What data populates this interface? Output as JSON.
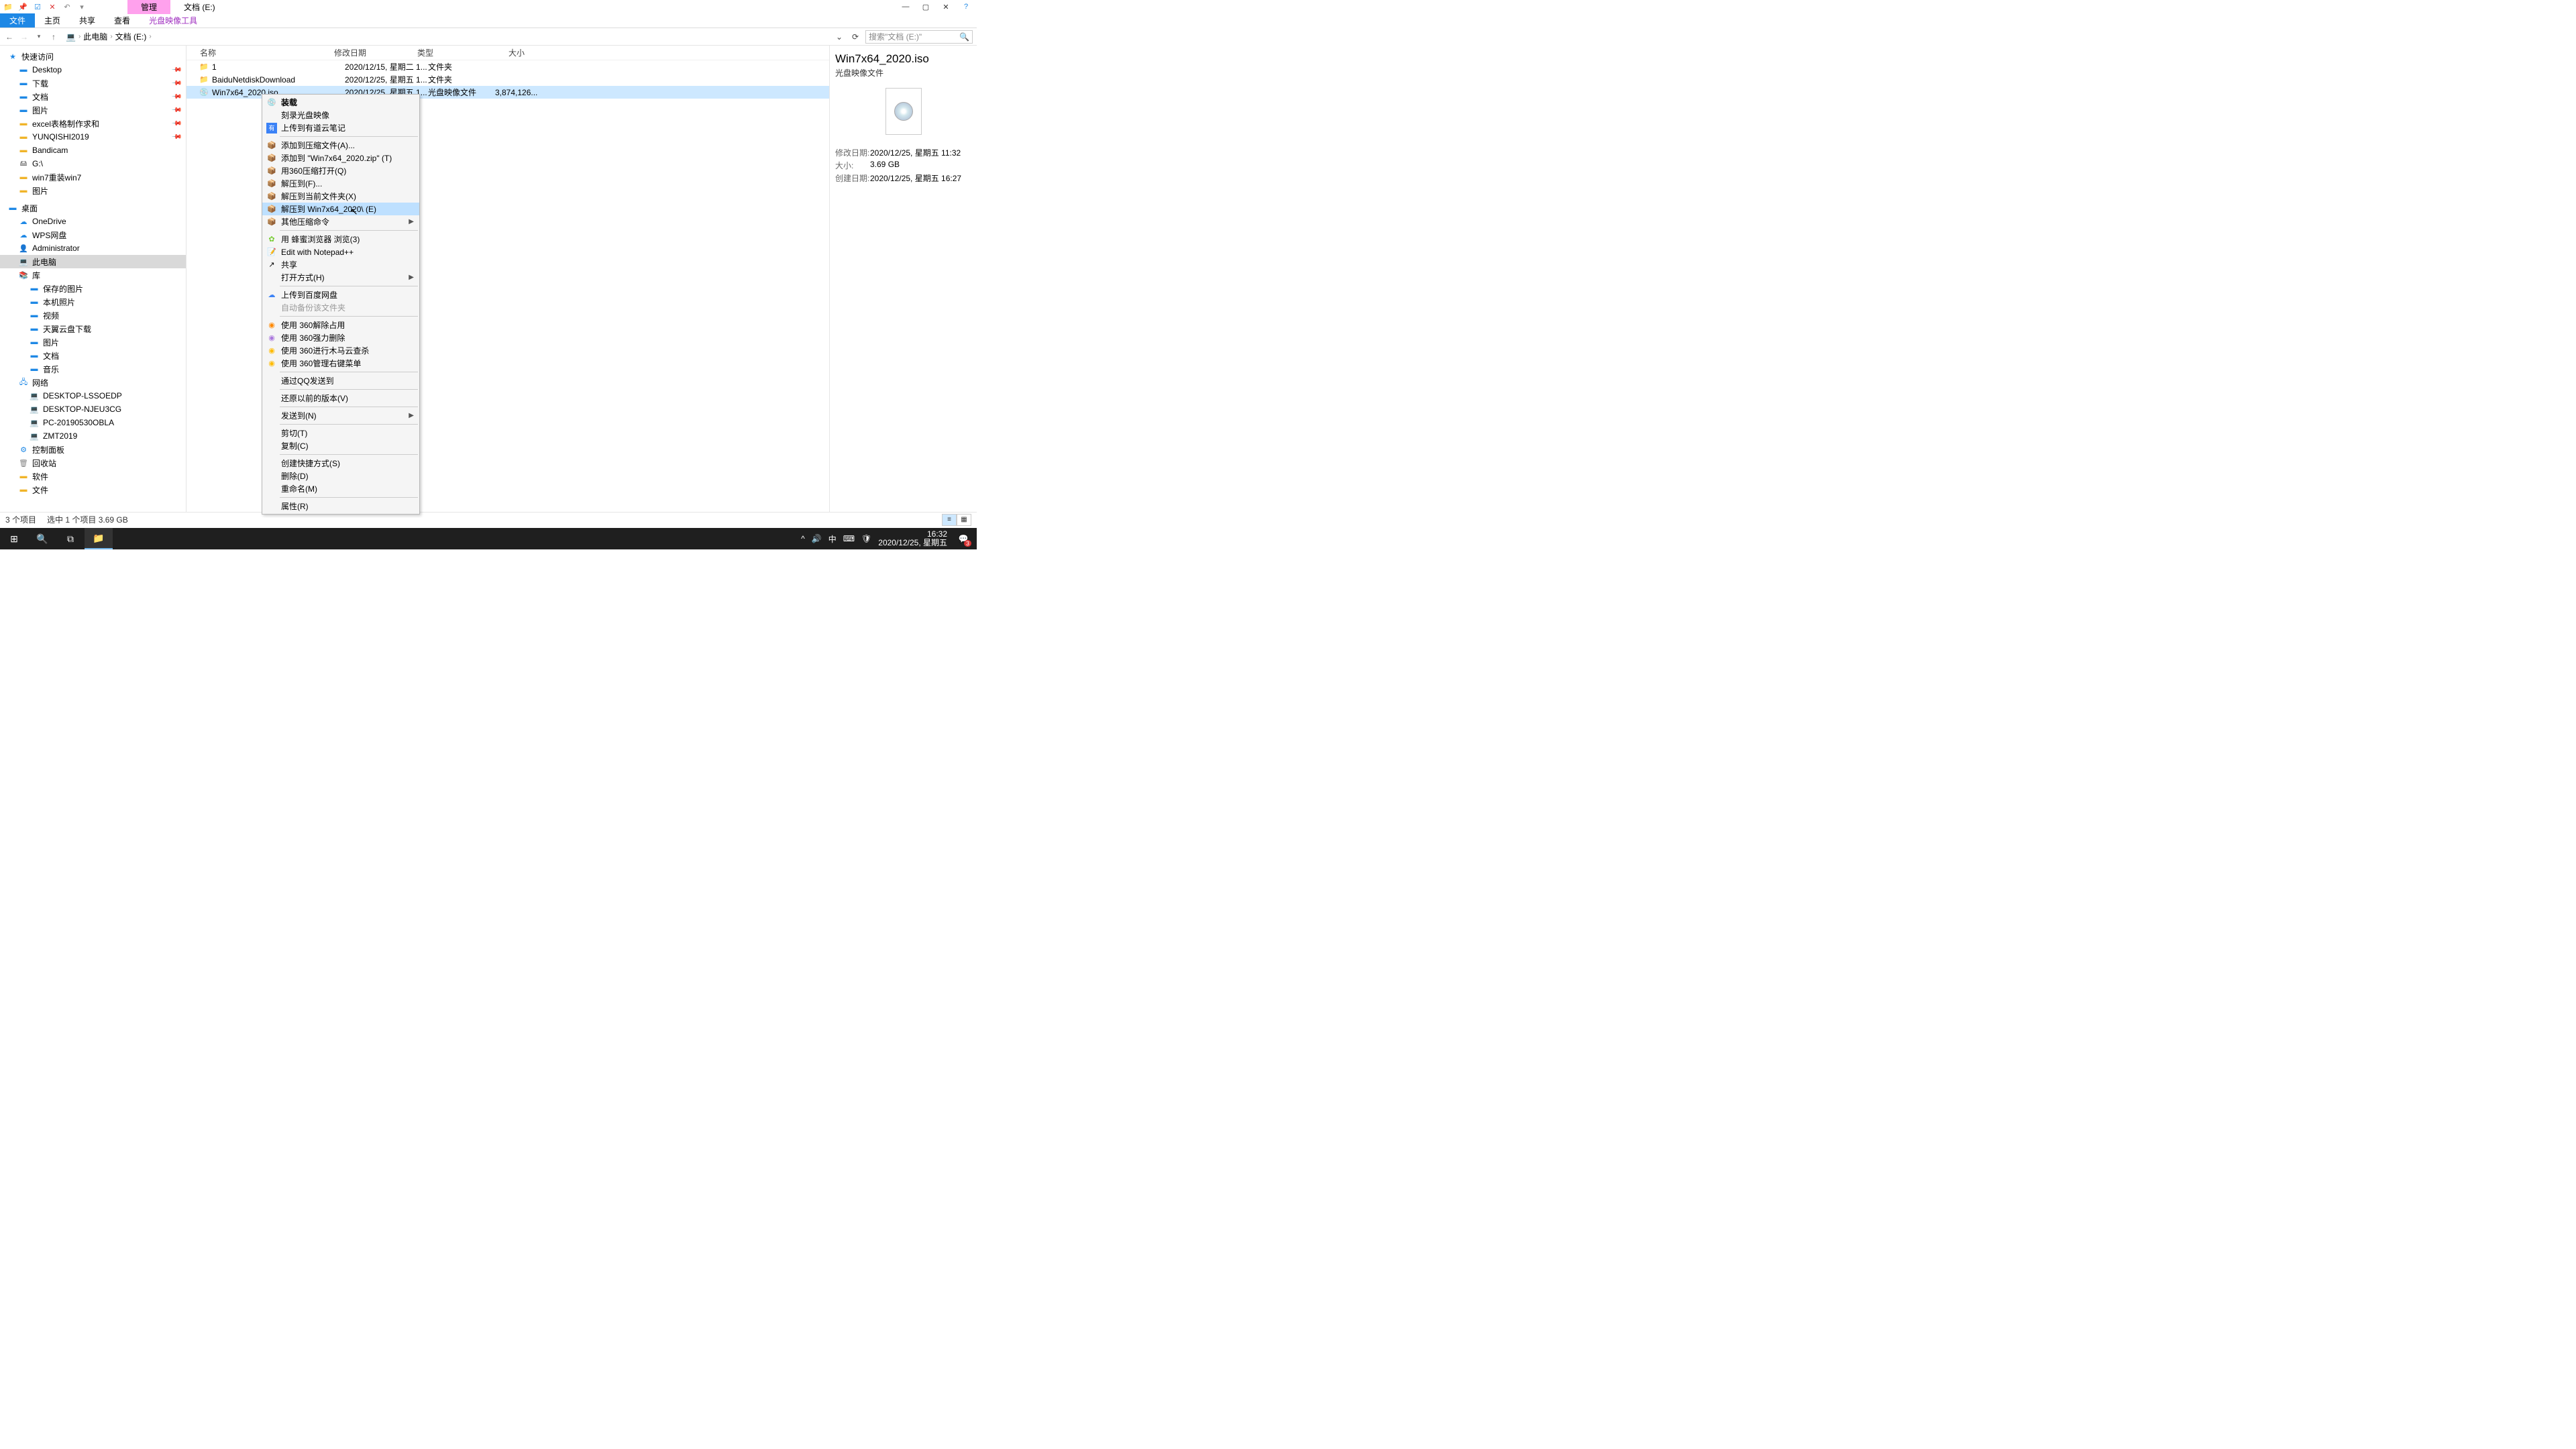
{
  "window": {
    "manage_tab": "管理",
    "title_tab": "文档 (E:)"
  },
  "ribbon": {
    "file": "文件",
    "home": "主页",
    "share": "共享",
    "view": "查看",
    "disc_tool": "光盘映像工具"
  },
  "breadcrumb": {
    "root": "此电脑",
    "loc": "文档 (E:)"
  },
  "search": {
    "placeholder": "搜索\"文档 (E:)\""
  },
  "tree": {
    "quick": "快速访问",
    "quick_items": [
      "Desktop",
      "下载",
      "文档",
      "图片",
      "excel表格制作求和",
      "YUNQISHI2019",
      "Bandicam",
      "G:\\",
      "win7重装win7",
      "图片"
    ],
    "desktop": "桌面",
    "desktop_items": [
      "OneDrive",
      "WPS网盘",
      "Administrator",
      "此电脑",
      "库"
    ],
    "lib_items": [
      "保存的图片",
      "本机照片",
      "视频",
      "天翼云盘下载",
      "图片",
      "文档",
      "音乐"
    ],
    "network": "网络",
    "net_items": [
      "DESKTOP-LSSOEDP",
      "DESKTOP-NJEU3CG",
      "PC-20190530OBLA",
      "ZMT2019"
    ],
    "extras": [
      "控制面板",
      "回收站",
      "软件",
      "文件"
    ]
  },
  "columns": {
    "name": "名称",
    "modified": "修改日期",
    "type": "类型",
    "size": "大小"
  },
  "rows": [
    {
      "icon": "📁",
      "name": "1",
      "modified": "2020/12/15, 星期二 1...",
      "type": "文件夹",
      "size": ""
    },
    {
      "icon": "📁",
      "name": "BaiduNetdiskDownload",
      "modified": "2020/12/25, 星期五 1...",
      "type": "文件夹",
      "size": ""
    },
    {
      "icon": "💿",
      "name": "Win7x64_2020.iso",
      "modified": "2020/12/25, 星期五 1...",
      "type": "光盘映像文件",
      "size": "3,874,126..."
    }
  ],
  "ctx": {
    "mount": "装载",
    "burn": "刻录光盘映像",
    "youdao": "上传到有道云笔记",
    "add_archive": "添加到压缩文件(A)...",
    "add_zip": "添加到 \"Win7x64_2020.zip\" (T)",
    "open_360zip": "用360压缩打开(Q)",
    "extract_to": "解压到(F)...",
    "extract_here": "解压到当前文件夹(X)",
    "extract_named": "解压到 Win7x64_2020\\ (E)",
    "other_zip": "其他压缩命令",
    "bee": "用 蜂蜜浏览器 浏览(3)",
    "npp": "Edit with Notepad++",
    "share": "共享",
    "open_with": "打开方式(H)",
    "baidu": "上传到百度网盘",
    "auto_backup": "自动备份该文件夹",
    "s360_unlock": "使用 360解除占用",
    "s360_force": "使用 360强力删除",
    "s360_trojan": "使用 360进行木马云查杀",
    "s360_mgr": "使用 360管理右键菜单",
    "qq": "通过QQ发送到",
    "restore": "还原以前的版本(V)",
    "send_to": "发送到(N)",
    "cut": "剪切(T)",
    "copy": "复制(C)",
    "shortcut": "创建快捷方式(S)",
    "delete": "删除(D)",
    "rename": "重命名(M)",
    "props": "属性(R)"
  },
  "preview": {
    "title": "Win7x64_2020.iso",
    "type": "光盘映像文件",
    "k_mod": "修改日期:",
    "v_mod": "2020/12/25, 星期五 11:32",
    "k_size": "大小:",
    "v_size": "3.69 GB",
    "k_created": "创建日期:",
    "v_created": "2020/12/25, 星期五 16:27"
  },
  "status": {
    "count": "3 个项目",
    "sel": "选中 1 个项目  3.69 GB"
  },
  "tray": {
    "ime": "中",
    "time": "16:32",
    "date": "2020/12/25, 星期五",
    "notif_count": "3"
  }
}
